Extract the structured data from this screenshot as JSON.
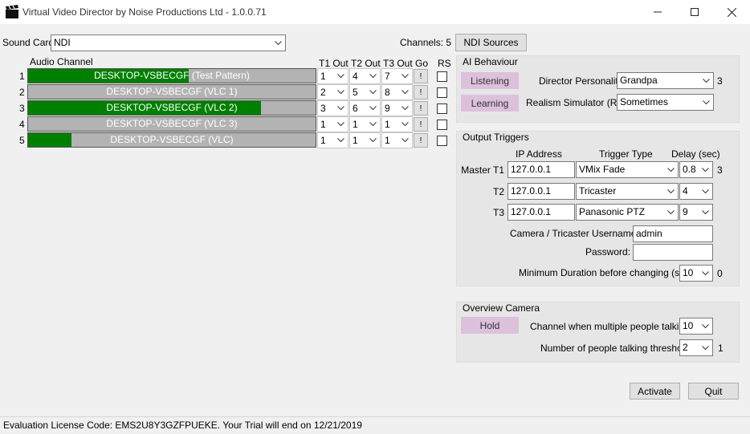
{
  "window": {
    "title": "Virtual Video Director by Noise Productions Ltd - 1.0.0.71",
    "icons": {
      "app": "clapperboard-icon",
      "minimize": "minimize-icon",
      "maximize": "maximize-icon",
      "close": "close-icon"
    }
  },
  "top": {
    "sound_card_label": "Sound Card",
    "sound_card_value": "NDI",
    "channels_label": "Channels: 5",
    "ndi_sources_label": "NDI Sources"
  },
  "table": {
    "headers": {
      "audio_channel": "Audio Channel",
      "t1": "T1 Out",
      "t2": "T2 Out",
      "t3": "T3 Out",
      "go": "Go",
      "rs": "RS"
    },
    "go_label": "!",
    "rows": [
      {
        "num": "1",
        "name": "DESKTOP-VSBECGF (Test Pattern)",
        "level": 0.56,
        "t1": "1",
        "t2": "4",
        "t3": "7"
      },
      {
        "num": "2",
        "name": "DESKTOP-VSBECGF (VLC 1)",
        "level": 0.0,
        "t1": "2",
        "t2": "5",
        "t3": "8"
      },
      {
        "num": "3",
        "name": "DESKTOP-VSBECGF (VLC 2)",
        "level": 0.81,
        "t1": "3",
        "t2": "6",
        "t3": "9"
      },
      {
        "num": "4",
        "name": "DESKTOP-VSBECGF (VLC 3)",
        "level": 0.0,
        "t1": "1",
        "t2": "1",
        "t3": "1"
      },
      {
        "num": "5",
        "name": "DESKTOP-VSBECGF (VLC)",
        "level": 0.15,
        "t1": "1",
        "t2": "1",
        "t3": "1"
      }
    ]
  },
  "ai": {
    "title": "AI Behaviour",
    "listening_label": "Listening",
    "learning_label": "Learning",
    "personality_label": "Director Personality",
    "personality_value": "Grandpa",
    "personality_num": "3",
    "realism_label": "Realism Simulator (RS)",
    "realism_value": "Sometimes"
  },
  "output": {
    "title": "Output Triggers",
    "ip_header": "IP Address",
    "type_header": "Trigger Type",
    "delay_header": "Delay (sec)",
    "rows": [
      {
        "label": "Master T1",
        "ip": "127.0.0.1",
        "type": "VMix Fade",
        "delay": "0.8",
        "extra": "3"
      },
      {
        "label": "T2",
        "ip": "127.0.0.1",
        "type": "Tricaster",
        "delay": "4",
        "extra": ""
      },
      {
        "label": "T3",
        "ip": "127.0.0.1",
        "type": "Panasonic PTZ",
        "delay": "9",
        "extra": ""
      }
    ],
    "username_label": "Camera / Tricaster Username:",
    "username_value": "admin",
    "password_label": "Password:",
    "password_value": "",
    "min_duration_label": "Minimum Duration before changing (sec)",
    "min_duration_value": "10",
    "min_duration_extra": "0"
  },
  "overview": {
    "title": "Overview Camera",
    "hold_label": "Hold",
    "multi_label": "Channel when multiple people talking",
    "multi_value": "10",
    "threshold_label": "Number of people talking threshold",
    "threshold_value": "2",
    "threshold_extra": "1"
  },
  "actions": {
    "activate_label": "Activate",
    "quit_label": "Quit"
  },
  "status": {
    "text": "Evaluation License Code: EMS2U8Y3GZFPUEKE. Your Trial will end on 12/21/2019"
  },
  "colors": {
    "meter_green": "#008000",
    "meter_grey": "#b3b3b3",
    "pink_button": "#dcc0dc"
  }
}
